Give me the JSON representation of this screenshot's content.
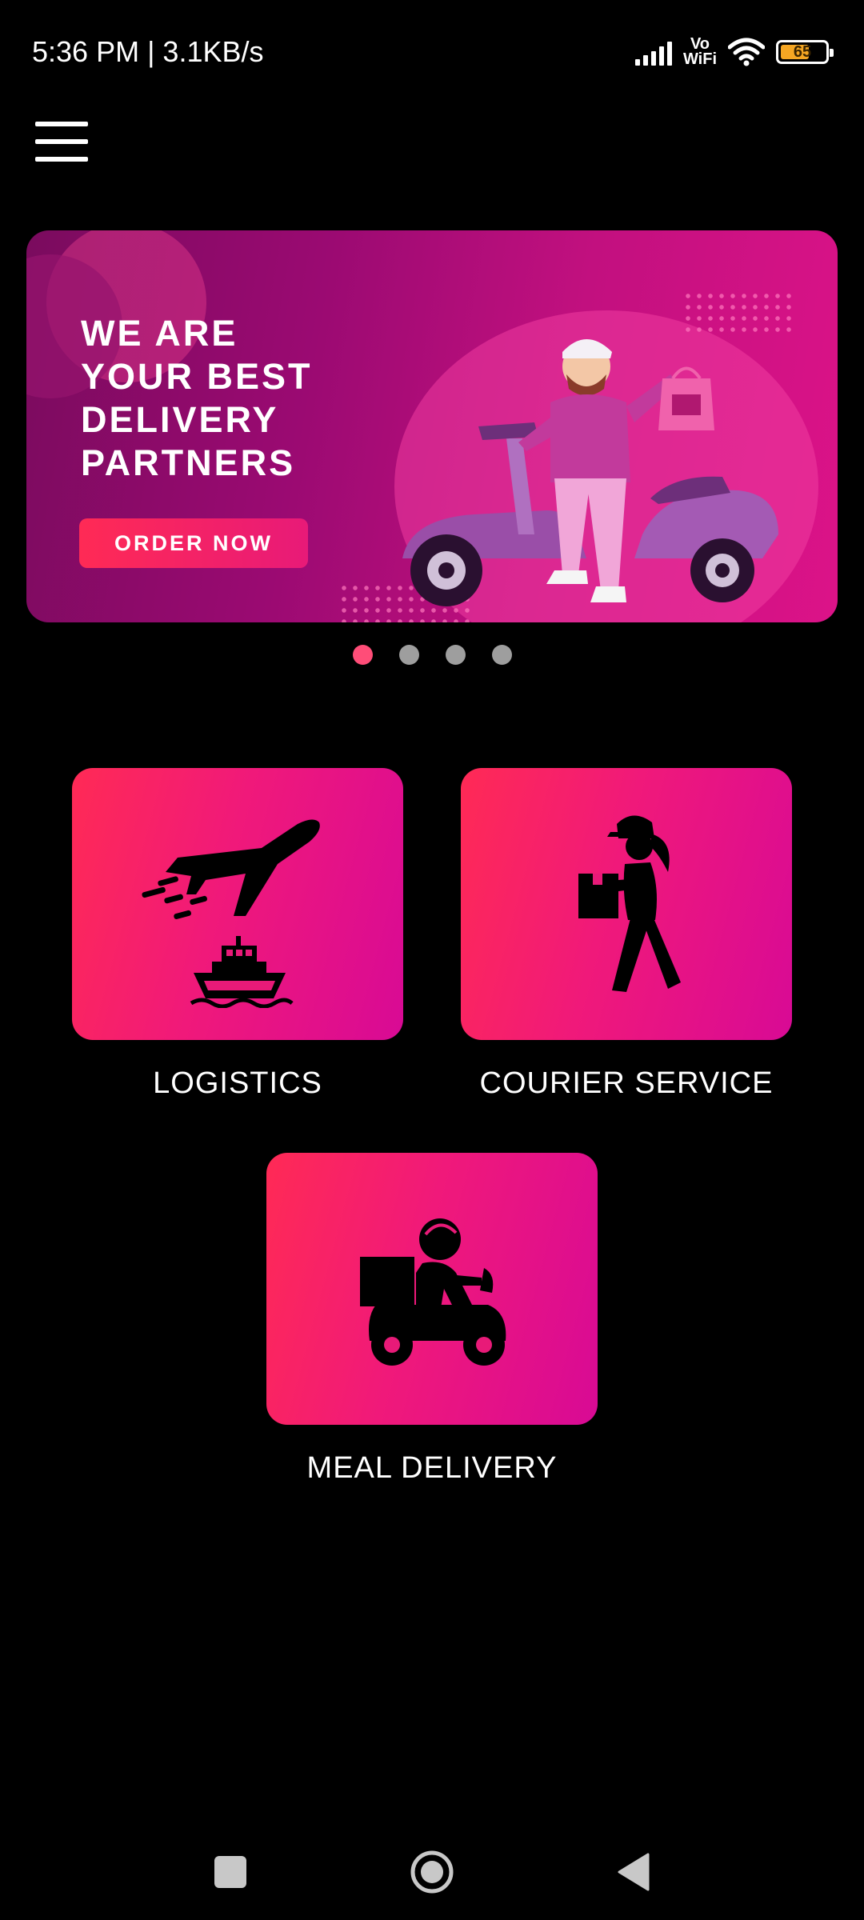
{
  "status_bar": {
    "time_speed": "5:36 PM | 3.1KB/s",
    "network_label_top": "Vo",
    "network_label_bottom": "WiFi",
    "battery_level": "65",
    "battery_fraction": 0.65,
    "battery_color": "#f5a623"
  },
  "header": {
    "menu_icon": "hamburger-menu-icon"
  },
  "banner": {
    "headline_lines": [
      "WE ARE",
      "YOUR BEST",
      "DELIVERY",
      "PARTNERS"
    ],
    "cta_label": "ORDER NOW",
    "illustration": "delivery-man-on-scooter",
    "pagination": {
      "total": 4,
      "active_index": 0
    }
  },
  "services": [
    {
      "label": "LOGISTICS",
      "icon": "plane-and-ship-icon"
    },
    {
      "label": "COURIER SERVICE",
      "icon": "courier-carrying-box-icon"
    },
    {
      "label": "MEAL DELIVERY",
      "icon": "scooter-rider-with-box-icon"
    }
  ],
  "colors": {
    "accent_start": "#ff2a55",
    "accent_end": "#d80a95",
    "background": "#000000",
    "pager_active": "#ff4d78",
    "pager_inactive": "#9e9e9e"
  },
  "navigation_bar": [
    "recent-apps",
    "home",
    "back"
  ]
}
